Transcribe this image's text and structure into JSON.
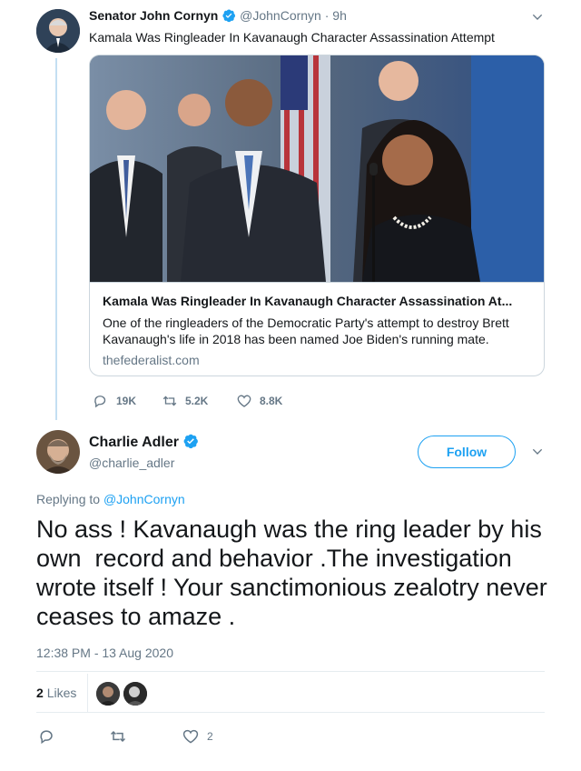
{
  "parent_tweet": {
    "author_name": "Senator John Cornyn",
    "handle": "@JohnCornyn",
    "separator": "·",
    "time": "9h",
    "text": "Kamala Was Ringleader In Kavanaugh Character Assassination Attempt",
    "card": {
      "title": "Kamala Was Ringleader In Kavanaugh Character Assassination At...",
      "description": "One of the ringleaders of the Democratic Party's attempt to destroy Brett Kavanaugh's life in 2018 has been named Joe Biden's running mate.",
      "domain": "thefederalist.com"
    },
    "stats": {
      "replies": "19K",
      "retweets": "5.2K",
      "likes": "8.8K"
    }
  },
  "reply_tweet": {
    "author_name": "Charlie Adler",
    "handle": "@charlie_adler",
    "follow_label": "Follow",
    "replying_prefix": "Replying to",
    "replying_handle": "@JohnCornyn",
    "text": "No ass ! Kavanaugh was the ring leader by his own  record and behavior .The investigation wrote itself ! Your sanctimonious zealotry never ceases to amaze .",
    "timestamp": "12:38 PM - 13 Aug 2020",
    "likes_count": "2",
    "likes_label": "Likes",
    "action_like_count": "2"
  },
  "colors": {
    "accent": "#1da1f2",
    "muted": "#657786",
    "thread_line": "#c4dff2",
    "border": "#ccd6dd"
  }
}
